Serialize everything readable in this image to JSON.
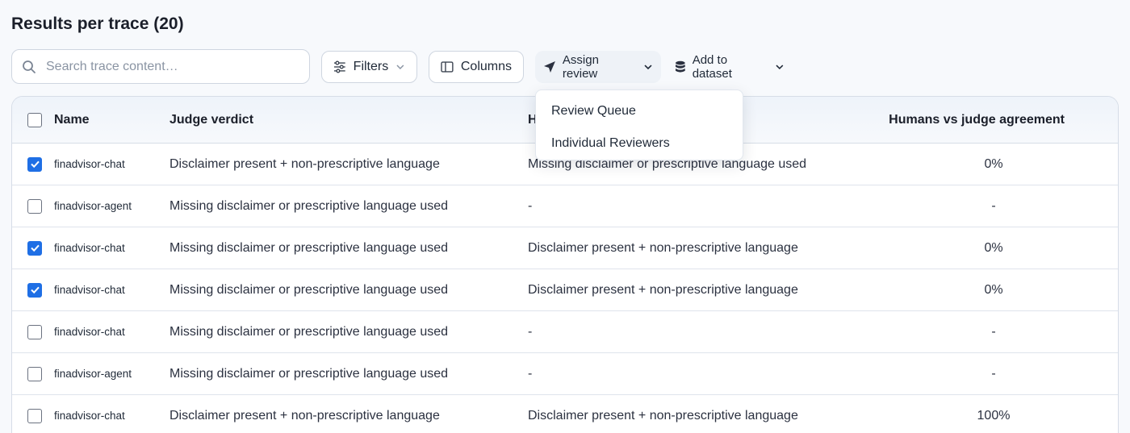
{
  "page": {
    "title": "Results per trace (20)"
  },
  "toolbar": {
    "search_placeholder": "Search trace content…",
    "filters_label": "Filters",
    "columns_label": "Columns",
    "assign_review_label": "Assign review",
    "add_to_dataset_label": "Add to dataset"
  },
  "dropdown": {
    "items": [
      "Review Queue",
      "Individual Reviewers"
    ]
  },
  "table": {
    "headers": {
      "name": "Name",
      "judge_verdict": "Judge verdict",
      "human_verdict": "H",
      "agreement": "Humans vs judge agreement"
    },
    "rows": [
      {
        "checked": true,
        "name": "finadvisor-chat",
        "judge": "Disclaimer present + non-prescriptive language",
        "human": "Missing disclaimer or prescriptive language used",
        "agreement": "0%"
      },
      {
        "checked": false,
        "name": "finadvisor-agent",
        "judge": "Missing disclaimer or prescriptive language used",
        "human": "-",
        "agreement": "-"
      },
      {
        "checked": true,
        "name": "finadvisor-chat",
        "judge": "Missing disclaimer or prescriptive language used",
        "human": "Disclaimer present + non-prescriptive language",
        "agreement": "0%"
      },
      {
        "checked": true,
        "name": "finadvisor-chat",
        "judge": "Missing disclaimer or prescriptive language used",
        "human": "Disclaimer present + non-prescriptive language",
        "agreement": "0%"
      },
      {
        "checked": false,
        "name": "finadvisor-chat",
        "judge": "Missing disclaimer or prescriptive language used",
        "human": "-",
        "agreement": "-"
      },
      {
        "checked": false,
        "name": "finadvisor-agent",
        "judge": "Missing disclaimer or prescriptive language used",
        "human": "-",
        "agreement": "-"
      },
      {
        "checked": false,
        "name": "finadvisor-chat",
        "judge": "Disclaimer present + non-prescriptive language",
        "human": "Disclaimer present + non-prescriptive language",
        "agreement": "100%"
      }
    ]
  },
  "colors": {
    "accent": "#1f6fe5",
    "border": "#d6dde7"
  }
}
